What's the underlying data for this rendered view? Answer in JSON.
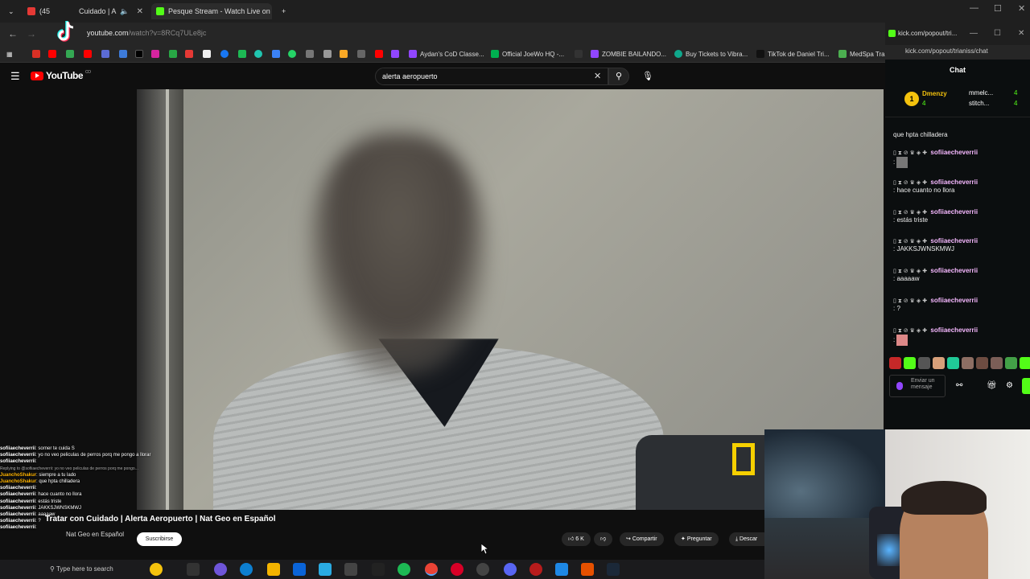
{
  "browser": {
    "tabs": [
      {
        "label": "(45",
        "color": "#e53935"
      },
      {
        "label": "Cuidado | A",
        "color": "#000000"
      },
      {
        "label": "Pesque Stream - Watch Live on",
        "color": "#53fc18"
      }
    ],
    "url_host": "youtube.com",
    "url_path": "/watch?v=8RCq7ULe8jc",
    "bookmarks": [
      {
        "label": "Aydan's CoD Classe...",
        "color": "#9146ff"
      },
      {
        "label": "Official JoeWo HQ -...",
        "color": "#00b050"
      },
      {
        "label": "ZOMBIE BAILANDO...",
        "color": "#9146ff"
      },
      {
        "label": "Buy Tickets to Vibra...",
        "color": "#0fa88c"
      },
      {
        "label": "TikTok de Daniel Tri...",
        "color": "#111111"
      },
      {
        "label": "MedSpa Tra",
        "color": "#4caf50"
      }
    ]
  },
  "youtube": {
    "logo": "YouTube",
    "country": "CO",
    "search_value": "alerta aeropuerto",
    "video_title": "Tratar con Cuidado | Alerta Aeropuerto | Nat Geo en Español",
    "channel": "Nat Geo en Español",
    "subscribe": "Suscribirse",
    "likes": "6 K",
    "share": "Compartir",
    "ask": "Preguntar",
    "download": "Descar"
  },
  "overlay_chat": [
    {
      "user": "sofiiaecheverrii",
      "text": "sorner te cuida S",
      "kind": "u"
    },
    {
      "user": "sofiiaecheverrii",
      "text": "yo no veo peliculas de perros porq me pongo a llorar",
      "kind": "u"
    },
    {
      "user": "sofiiaecheverrii",
      "text": "",
      "kind": "u"
    },
    {
      "user": "",
      "text": "Replying to @sofiiaecheverrii: yo no veo peliculas de perros porq me pongo...",
      "kind": "rep"
    },
    {
      "user": "JuanchoShakur",
      "text": "siempre a tu lado",
      "kind": "u2"
    },
    {
      "user": "JuanchoShakur",
      "text": "que hpta chilladera",
      "kind": "u2"
    },
    {
      "user": "sofiiaecheverrii",
      "text": "",
      "kind": "u"
    },
    {
      "user": "sofiiaecheverrii",
      "text": "hace cuanto no llora",
      "kind": "u"
    },
    {
      "user": "sofiiaecheverrii",
      "text": "estás triste",
      "kind": "u"
    },
    {
      "user": "sofiiaecheverrii",
      "text": "JAKKSJWNSKMWJ",
      "kind": "u"
    },
    {
      "user": "sofiiaecheverrii",
      "text": "aaaaaw",
      "kind": "u"
    },
    {
      "user": "sofiiaecheverrii",
      "text": "?",
      "kind": "u"
    },
    {
      "user": "sofiiaecheverrii",
      "text": "",
      "kind": "u"
    }
  ],
  "taskbar": {
    "search_placeholder": "Type here to search"
  },
  "kick": {
    "url": "kick.com/popout/trianiss/chat",
    "tab_label": "kick.com/popout/tri...",
    "title": "Chat",
    "gifters": [
      {
        "name": "Dmenzy",
        "count": "4"
      },
      {
        "name": "mmelc...",
        "count": "4"
      },
      {
        "name": "stitch...",
        "count": "4"
      }
    ],
    "top_message": "que hpta chilladera",
    "messages": [
      {
        "name": "sofiiaecheverrii",
        "text": ":"
      },
      {
        "name": "sofiiaecheverrii",
        "text": ": hace cuanto no llora"
      },
      {
        "name": "sofiiaecheverrii",
        "text": ": estás triste"
      },
      {
        "name": "sofiiaecheverrii",
        "text": ": JAKKSJWNSKMWJ"
      },
      {
        "name": "sofiiaecheverrii",
        "text": ": aaaaaw"
      },
      {
        "name": "sofiiaecheverrii",
        "text": ": ?"
      },
      {
        "name": "sofiiaecheverrii",
        "text": ":"
      }
    ],
    "send_placeholder": "Enviar un mensaje"
  }
}
